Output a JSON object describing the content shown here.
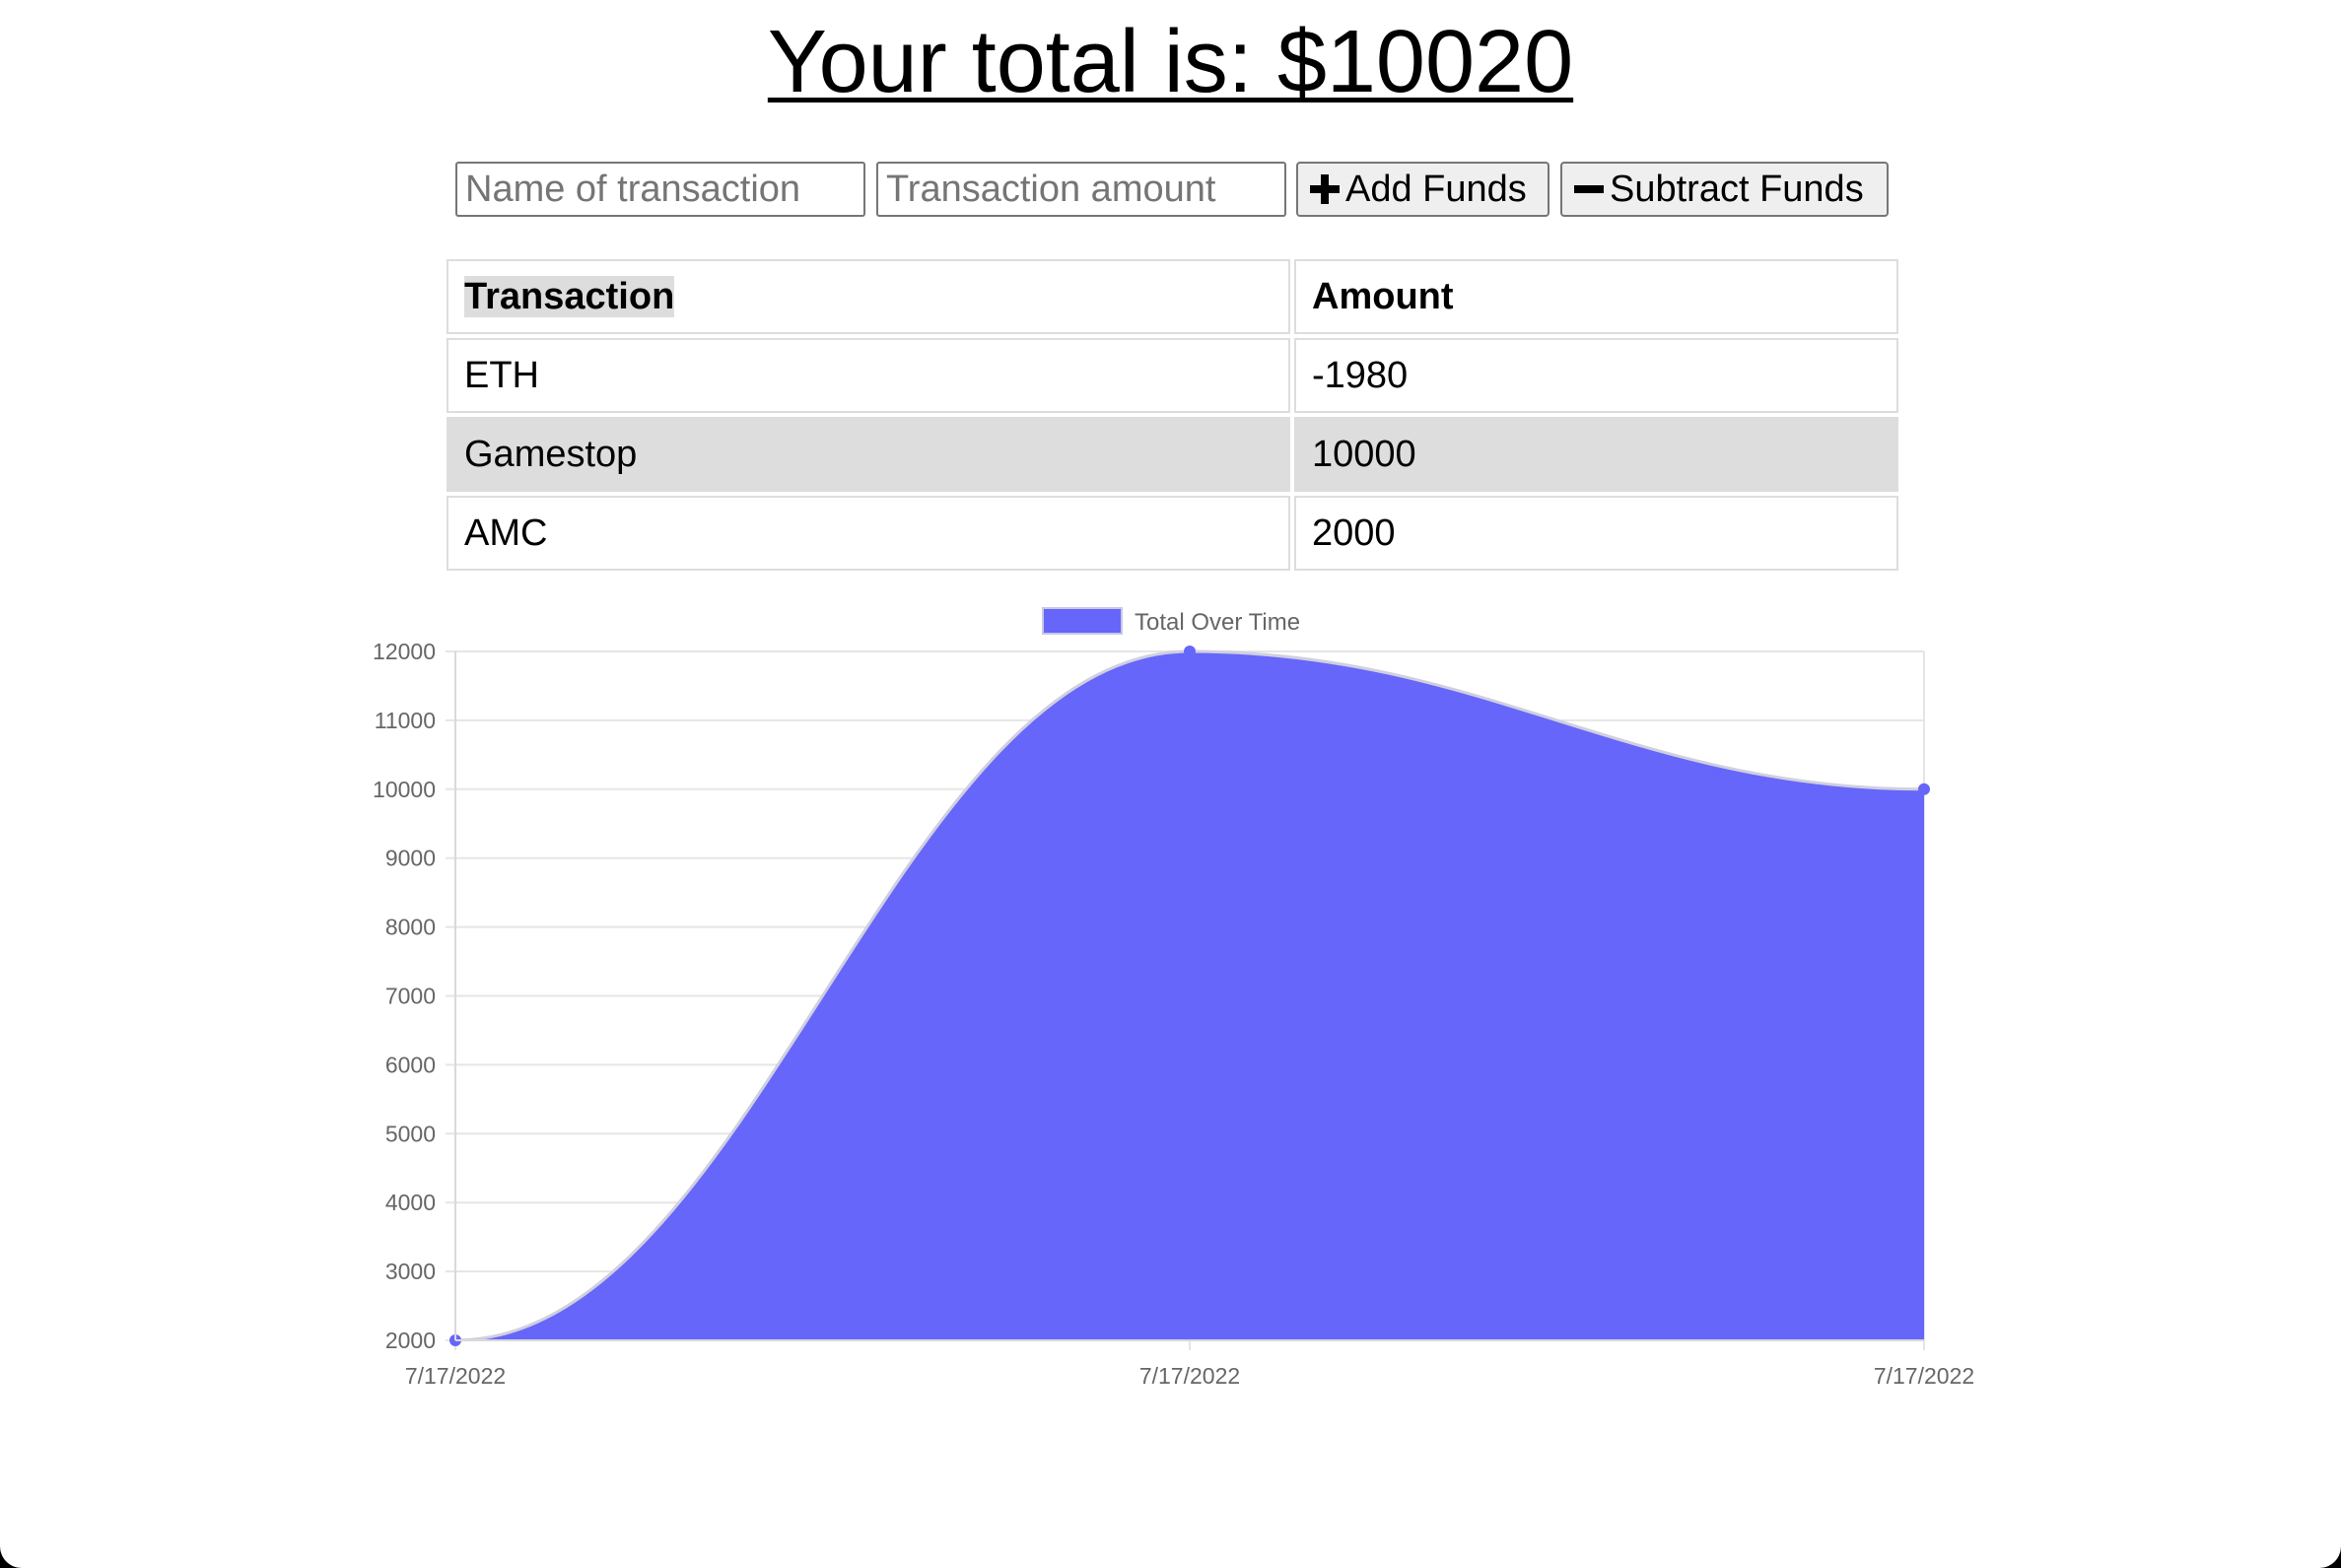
{
  "header": {
    "total_text": "Your total is: $10020"
  },
  "form": {
    "name_placeholder": "Name of transaction",
    "amount_placeholder": "Transaction amount",
    "add_label": "Add Funds",
    "subtract_label": "Subtract Funds",
    "add_icon": "plus-icon",
    "subtract_icon": "minus-icon"
  },
  "table": {
    "headers": [
      "Transaction",
      "Amount"
    ],
    "rows": [
      {
        "name": "ETH",
        "amount": "-1980"
      },
      {
        "name": "Gamestop",
        "amount": "10000"
      },
      {
        "name": "AMC",
        "amount": "2000"
      }
    ],
    "shaded_row_color": "#dddddd"
  },
  "chart_data": {
    "type": "area",
    "categories": [
      "7/17/2022",
      "7/17/2022",
      "7/17/2022"
    ],
    "series": [
      {
        "name": "Total Over Time",
        "values": [
          2000,
          12000,
          10000
        ],
        "color": "#6666fa"
      }
    ],
    "ylim": [
      2000,
      12000
    ],
    "yticks": [
      2000,
      3000,
      4000,
      5000,
      6000,
      7000,
      8000,
      9000,
      10000,
      11000,
      12000
    ],
    "grid": true,
    "legend_position": "top-center"
  }
}
